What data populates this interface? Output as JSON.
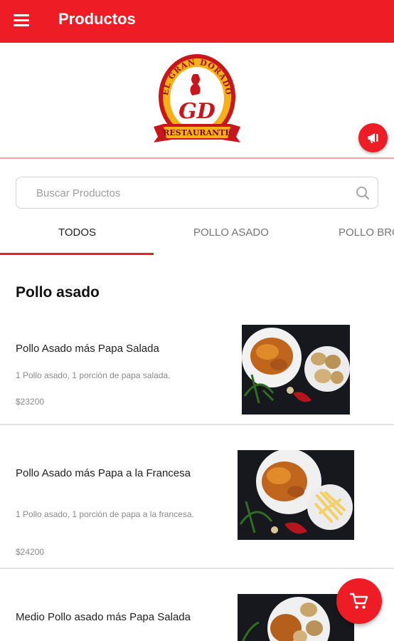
{
  "appbar": {
    "title": "Productos",
    "menu_icon": "hamburger-menu-icon"
  },
  "logo": {
    "top_text": "EL GRAN DORADO",
    "monogram": "GD",
    "banner_text": "RESTAURANTE"
  },
  "promo_button": {
    "icon": "megaphone-icon"
  },
  "search": {
    "placeholder": "Buscar Productos",
    "value": "",
    "icon": "search-icon"
  },
  "tabs": [
    {
      "label": "TODOS",
      "active": true
    },
    {
      "label": "POLLO ASADO",
      "active": false
    },
    {
      "label": "POLLO BROASTER",
      "active": false
    }
  ],
  "section": {
    "title": "Pollo asado"
  },
  "products": [
    {
      "name": "Pollo Asado más Papa Salada",
      "description": "1 Pollo asado, 1 porción de papa salada.",
      "price": "$23200"
    },
    {
      "name": "Pollo Asado más Papa a la Francesa",
      "description": "1 Pollo asado, 1 porción de papa a la francesa.",
      "price": "$24200"
    },
    {
      "name": "Medio Pollo asado más Papa Salada",
      "description": "",
      "price": ""
    }
  ],
  "cart_button": {
    "icon": "shopping-cart-icon"
  },
  "colors": {
    "primary": "#ee1c25",
    "divider": "#e3e3e3",
    "text_secondary": "#8a8a8a"
  }
}
